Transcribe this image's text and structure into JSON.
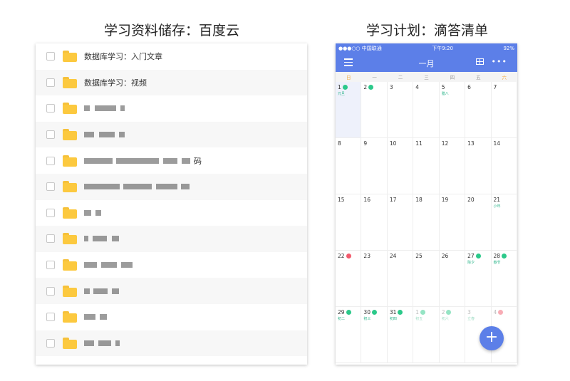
{
  "titles": {
    "left": "学习资料储存：百度云",
    "right": "学习计划：滴答清单"
  },
  "file_list": {
    "rows": [
      {
        "name": "数据库学习：入门文章"
      },
      {
        "name": "数据库学习：视频"
      },
      {
        "name": ""
      },
      {
        "name": ""
      },
      {
        "name": "码"
      },
      {
        "name": ""
      },
      {
        "name": ""
      },
      {
        "name": ""
      },
      {
        "name": ""
      },
      {
        "name": ""
      },
      {
        "name": ""
      },
      {
        "name": ""
      }
    ]
  },
  "calendar": {
    "status": {
      "carrier": "●●●○○ 中国联通",
      "time": "下午9:20",
      "battery": "92%"
    },
    "month": "一月",
    "weekdays": [
      "日",
      "一",
      "二",
      "三",
      "四",
      "五",
      "六"
    ],
    "days": [
      {
        "d": "1",
        "lunar": "元旦",
        "badge": "green",
        "today": true
      },
      {
        "d": "2",
        "badge": "green"
      },
      {
        "d": "3"
      },
      {
        "d": "4"
      },
      {
        "d": "5",
        "lunar": "腊八"
      },
      {
        "d": "6"
      },
      {
        "d": "7"
      },
      {
        "d": "8"
      },
      {
        "d": "9"
      },
      {
        "d": "10"
      },
      {
        "d": "11"
      },
      {
        "d": "12"
      },
      {
        "d": "13"
      },
      {
        "d": "14"
      },
      {
        "d": "15"
      },
      {
        "d": "16"
      },
      {
        "d": "17"
      },
      {
        "d": "18"
      },
      {
        "d": "19"
      },
      {
        "d": "20"
      },
      {
        "d": "21",
        "lunar": "小年"
      },
      {
        "d": "22",
        "badge": "red"
      },
      {
        "d": "23"
      },
      {
        "d": "24"
      },
      {
        "d": "25"
      },
      {
        "d": "26"
      },
      {
        "d": "27",
        "lunar": "除夕",
        "badge": "green"
      },
      {
        "d": "28",
        "lunar": "春节",
        "badge": "green"
      },
      {
        "d": "29",
        "lunar": "初二",
        "badge": "green"
      },
      {
        "d": "30",
        "lunar": "初三",
        "badge": "green"
      },
      {
        "d": "31",
        "lunar": "初四",
        "badge": "green"
      },
      {
        "d": "1",
        "lunar": "初五",
        "badge": "green",
        "dim": true
      },
      {
        "d": "2",
        "lunar": "初六",
        "badge": "green",
        "dim": true
      },
      {
        "d": "3",
        "lunar": "立春",
        "dim": true
      },
      {
        "d": "4",
        "badge": "red",
        "dim": true
      }
    ],
    "fab_label": "+"
  },
  "colors": {
    "accent": "#5c7fe8",
    "folder": "#fcc93f",
    "lunar_green": "#2bb58a",
    "badge_red": "#f25a6c"
  }
}
